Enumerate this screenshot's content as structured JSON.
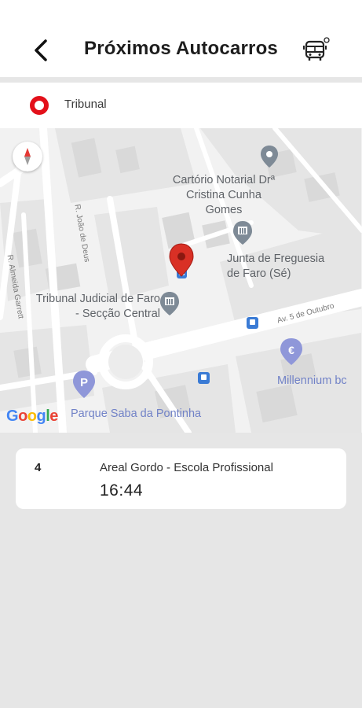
{
  "header": {
    "title": "Próximos Autocarros",
    "back_icon": "chevron-left-icon",
    "bus_icon": "bus-icon"
  },
  "stop": {
    "name": "Tribunal",
    "icon": "stop-marker-icon",
    "icon_color": "#e3101a"
  },
  "map": {
    "labels": {
      "cartorio": "Cartório Notarial Drª Cristina Cunha Gomes",
      "junta": "Junta de Freguesia de Faro (Sé)",
      "tribunal": "Tribunal Judicial de Faro - Secção Central",
      "millennium": "Millennium bc",
      "parque": "Parque Saba da Pontinha",
      "street_av": "Av. 5 de Outubro",
      "street_joao": "R. João de Deus",
      "street_almeida": "R. Almeida Garrett"
    },
    "google_logo": "Google",
    "marker_color": "#d93025",
    "poi_color_grey": "#5f6368",
    "poi_color_blue": "#7182c7"
  },
  "arrivals": [
    {
      "route": "4",
      "destination": "Areal Gordo - Escola Profissional",
      "time": "16:44"
    }
  ]
}
